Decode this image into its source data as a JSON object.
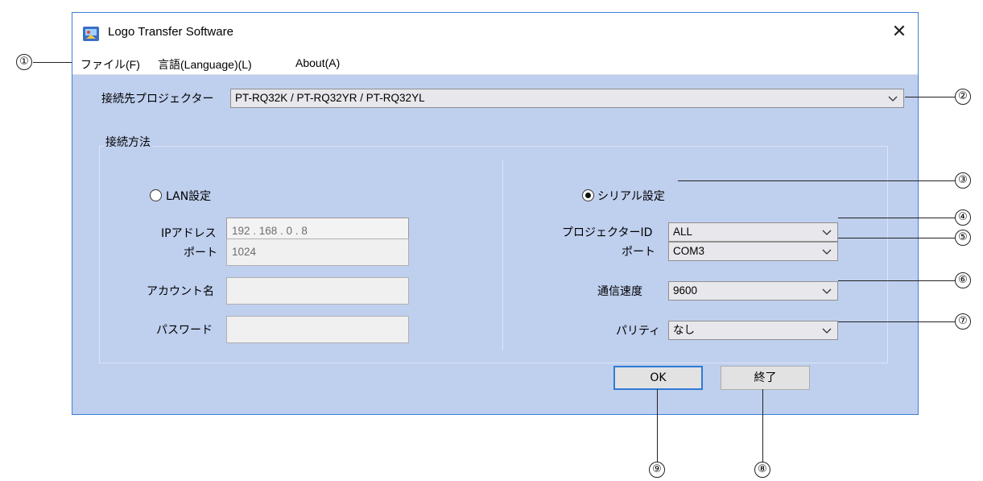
{
  "window": {
    "title": "Logo Transfer Software",
    "close_glyph": "✕"
  },
  "menu": [
    {
      "label": "ファイル(F)"
    },
    {
      "label": "言語(Language)(L)"
    },
    {
      "label": "About(A)"
    }
  ],
  "projector": {
    "label": "接続先プロジェクター",
    "value": "PT-RQ32K / PT-RQ32YR / PT-RQ32YL"
  },
  "connection": {
    "group_label": "接続方法",
    "lan": {
      "radio_label": "LAN設定",
      "selected": false,
      "ip_label": "IPアドレス",
      "ip_value": "192 . 168 . 0 . 8",
      "port_label": "ポート",
      "port_value": "1024",
      "account_label": "アカウント名",
      "account_value": "",
      "password_label": "パスワード",
      "password_value": ""
    },
    "serial": {
      "radio_label": "シリアル設定",
      "selected": true,
      "projector_id_label": "プロジェクターID",
      "projector_id_value": "ALL",
      "port_label": "ポート",
      "port_value": "COM3",
      "speed_label": "通信速度",
      "speed_value": "9600",
      "parity_label": "パリティ",
      "parity_value": "なし"
    }
  },
  "buttons": {
    "ok": "OK",
    "exit": "終了"
  },
  "callouts": {
    "n1": "①",
    "n2": "②",
    "n3": "③",
    "n4": "④",
    "n5": "⑤",
    "n6": "⑥",
    "n7": "⑦",
    "n8": "⑧",
    "n9": "⑨"
  },
  "colors": {
    "client_bg": "#bfcfee",
    "accent": "#2f7bd5"
  }
}
